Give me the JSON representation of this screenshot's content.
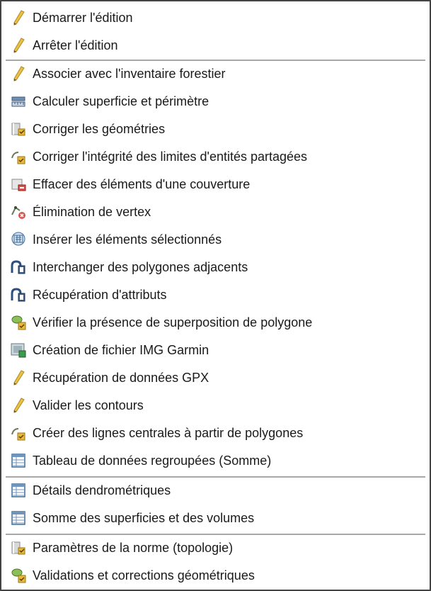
{
  "menu": {
    "groups": [
      [
        {
          "label": "Démarrer l'édition",
          "icon": "pencil-icon"
        },
        {
          "label": "Arrêter l'édition",
          "icon": "pencil-icon"
        }
      ],
      [
        {
          "label": "Associer avec l'inventaire forestier",
          "icon": "pencil-icon"
        },
        {
          "label": "Calculer superficie et périmètre",
          "icon": "measure-icon"
        },
        {
          "label": "Corriger les géométries",
          "icon": "geometry-tool-icon"
        },
        {
          "label": "Corriger l'intégrité des limites d'entités partagées",
          "icon": "line-edit-icon"
        },
        {
          "label": "Effacer des éléments d'une couverture",
          "icon": "erase-icon"
        },
        {
          "label": "Élimination de vertex",
          "icon": "vertex-delete-icon"
        },
        {
          "label": "Insérer les éléments sélectionnés",
          "icon": "insert-icon"
        },
        {
          "label": "Interchanger des polygones adjacents",
          "icon": "swap-polygon-icon"
        },
        {
          "label": "Récupération d'attributs",
          "icon": "swap-polygon-icon"
        },
        {
          "label": "Vérifier la présence de superposition de polygone",
          "icon": "overlap-check-icon"
        },
        {
          "label": "Création de fichier IMG Garmin",
          "icon": "garmin-icon"
        },
        {
          "label": "Récupération de données GPX",
          "icon": "pencil-icon"
        },
        {
          "label": "Valider les contours",
          "icon": "pencil-icon"
        },
        {
          "label": "Créer des lignes centrales à partir de polygones",
          "icon": "line-edit-icon"
        },
        {
          "label": "Tableau de données regroupées (Somme)",
          "icon": "table-icon"
        }
      ],
      [
        {
          "label": "Détails dendrométriques",
          "icon": "table-icon"
        },
        {
          "label": "Somme des superficies et des volumes",
          "icon": "table-icon"
        }
      ],
      [
        {
          "label": "Paramètres de la norme (topologie)",
          "icon": "geometry-tool-icon"
        },
        {
          "label": "Validations et corrections géométriques",
          "icon": "overlap-check-icon"
        }
      ]
    ]
  }
}
